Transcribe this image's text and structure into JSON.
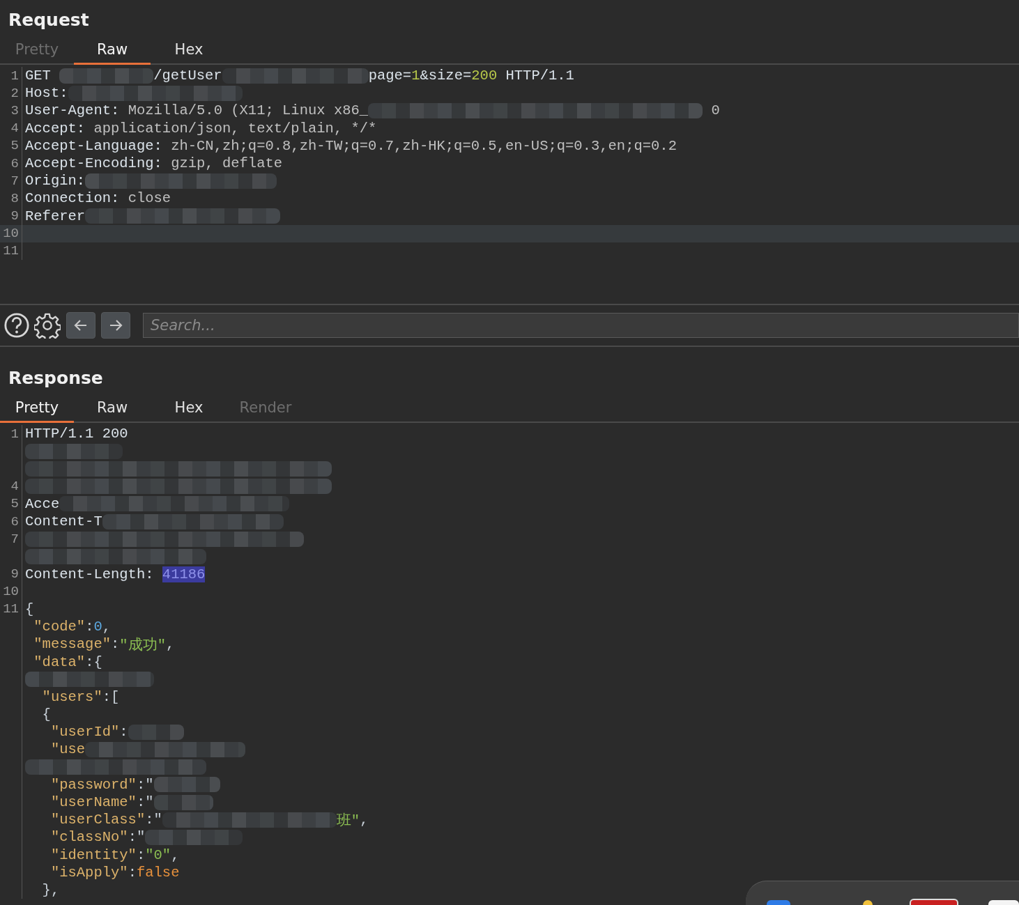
{
  "request": {
    "title": "Request",
    "tabs": [
      {
        "label": "Pretty",
        "selected": false,
        "disabled": true
      },
      {
        "label": "Raw",
        "selected": true,
        "disabled": false
      },
      {
        "label": "Hex",
        "selected": false,
        "disabled": false
      }
    ],
    "lines": [
      {
        "no": "1",
        "highlighted": false,
        "parts": [
          {
            "kind": "name",
            "text": "GET "
          },
          {
            "kind": "redacted"
          },
          {
            "kind": "name",
            "text": "/getUser"
          },
          {
            "kind": "redacted"
          },
          {
            "kind": "name",
            "text": "page="
          },
          {
            "kind": "num",
            "text": "1"
          },
          {
            "kind": "name",
            "text": "&size="
          },
          {
            "kind": "num",
            "text": "200"
          },
          {
            "kind": "name",
            "text": " HTTP/1.1"
          }
        ]
      },
      {
        "no": "2",
        "highlighted": false,
        "parts": [
          {
            "kind": "name",
            "text": "Host:"
          },
          {
            "kind": "redacted"
          }
        ]
      },
      {
        "no": "3",
        "highlighted": false,
        "parts": [
          {
            "kind": "name",
            "text": "User-Agent:"
          },
          {
            "kind": "value",
            "text": " Mozilla/5.0 (X11; Linux x86_"
          },
          {
            "kind": "redacted"
          },
          {
            "kind": "value",
            "text": " 0"
          }
        ]
      },
      {
        "no": "4",
        "highlighted": false,
        "parts": [
          {
            "kind": "name",
            "text": "Accept:"
          },
          {
            "kind": "value",
            "text": " application/json, text/plain, */*"
          }
        ]
      },
      {
        "no": "5",
        "highlighted": false,
        "parts": [
          {
            "kind": "name",
            "text": "Accept-Language:"
          },
          {
            "kind": "value",
            "text": " zh-CN,zh;q=0.8,zh-TW;q=0.7,zh-HK;q=0.5,en-US;q=0.3,en;q=0.2"
          }
        ]
      },
      {
        "no": "6",
        "highlighted": false,
        "parts": [
          {
            "kind": "name",
            "text": "Accept-Encoding:"
          },
          {
            "kind": "value",
            "text": " gzip, deflate"
          }
        ]
      },
      {
        "no": "7",
        "highlighted": false,
        "parts": [
          {
            "kind": "name",
            "text": "Origin:"
          },
          {
            "kind": "redacted"
          }
        ]
      },
      {
        "no": "8",
        "highlighted": false,
        "parts": [
          {
            "kind": "name",
            "text": "Connection:"
          },
          {
            "kind": "value",
            "text": " close"
          }
        ]
      },
      {
        "no": "9",
        "highlighted": false,
        "parts": [
          {
            "kind": "name",
            "text": "Referer"
          },
          {
            "kind": "redacted"
          }
        ]
      },
      {
        "no": "10",
        "highlighted": true
      },
      {
        "no": "11",
        "highlighted": false
      }
    ]
  },
  "toolbar": {
    "search": {
      "placeholder": "Search..."
    }
  },
  "response": {
    "title": "Response",
    "tabs": [
      {
        "label": "Pretty",
        "selected": true,
        "disabled": false
      },
      {
        "label": "Raw",
        "selected": false,
        "disabled": false
      },
      {
        "label": "Hex",
        "selected": false,
        "disabled": false
      },
      {
        "label": "Render",
        "selected": false,
        "disabled": true
      }
    ],
    "lines": [
      {
        "no": "1",
        "highlighted": false,
        "parts": [
          {
            "kind": "name",
            "text": "HTTP/1.1 200"
          }
        ]
      },
      {
        "highlighted": false,
        "parts": [
          {
            "kind": "redacted"
          }
        ]
      },
      {
        "highlighted": false,
        "parts": [
          {
            "kind": "redacted"
          }
        ]
      },
      {
        "no": "4",
        "highlighted": false,
        "parts": [
          {
            "kind": "redacted"
          }
        ]
      },
      {
        "no": "5",
        "highlighted": false,
        "parts": [
          {
            "kind": "name",
            "text": "Acce"
          },
          {
            "kind": "redacted"
          }
        ]
      },
      {
        "no": "6",
        "highlighted": false,
        "parts": [
          {
            "kind": "name",
            "text": "Content-T"
          },
          {
            "kind": "redacted"
          }
        ]
      },
      {
        "no": "7",
        "highlighted": false,
        "parts": [
          {
            "kind": "redacted"
          }
        ]
      },
      {
        "highlighted": false,
        "parts": [
          {
            "kind": "redacted"
          }
        ]
      },
      {
        "no": "9",
        "highlighted": false,
        "parts": [
          {
            "kind": "name",
            "text": "Content-Length: "
          },
          {
            "kind": "selected",
            "text": "41186"
          }
        ]
      },
      {
        "no": "10",
        "highlighted": false
      },
      {
        "no": "11",
        "highlighted": false,
        "parts": [
          {
            "kind": "punct",
            "text": "{"
          }
        ]
      },
      {
        "highlighted": false,
        "parts": [
          {
            "kind": "key",
            "text": " \"code\""
          },
          {
            "kind": "punct",
            "text": ":"
          },
          {
            "kind": "jnum",
            "text": "0"
          },
          {
            "kind": "punct",
            "text": ","
          }
        ]
      },
      {
        "highlighted": false,
        "parts": [
          {
            "kind": "key",
            "text": " \"message\""
          },
          {
            "kind": "punct",
            "text": ":"
          },
          {
            "kind": "jstr",
            "text": "\"成功\""
          },
          {
            "kind": "punct",
            "text": ","
          }
        ]
      },
      {
        "highlighted": false,
        "parts": [
          {
            "kind": "key",
            "text": " \"data\""
          },
          {
            "kind": "punct",
            "text": ":{"
          }
        ]
      },
      {
        "highlighted": false,
        "parts": [
          {
            "kind": "redacted"
          }
        ]
      },
      {
        "highlighted": false,
        "parts": [
          {
            "kind": "key",
            "text": "  \"users\""
          },
          {
            "kind": "punct",
            "text": ":["
          }
        ]
      },
      {
        "highlighted": false,
        "parts": [
          {
            "kind": "punct",
            "text": "  {"
          }
        ]
      },
      {
        "highlighted": false,
        "parts": [
          {
            "kind": "key",
            "text": "   \"userId\""
          },
          {
            "kind": "punct",
            "text": ":"
          },
          {
            "kind": "redacted"
          }
        ]
      },
      {
        "highlighted": false,
        "parts": [
          {
            "kind": "key",
            "text": "   \"use"
          },
          {
            "kind": "redacted"
          }
        ]
      },
      {
        "highlighted": false,
        "parts": [
          {
            "kind": "redacted"
          }
        ]
      },
      {
        "highlighted": false,
        "parts": [
          {
            "kind": "key",
            "text": "   \"password\""
          },
          {
            "kind": "punct",
            "text": ":\""
          },
          {
            "kind": "redacted"
          }
        ]
      },
      {
        "highlighted": false,
        "parts": [
          {
            "kind": "key",
            "text": "   \"userName\""
          },
          {
            "kind": "punct",
            "text": ":\""
          },
          {
            "kind": "redacted"
          }
        ]
      },
      {
        "highlighted": false,
        "parts": [
          {
            "kind": "key",
            "text": "   \"userClass\""
          },
          {
            "kind": "punct",
            "text": ":\""
          },
          {
            "kind": "redacted"
          },
          {
            "kind": "jstr",
            "text": "班\""
          },
          {
            "kind": "punct",
            "text": ","
          }
        ]
      },
      {
        "highlighted": false,
        "parts": [
          {
            "kind": "key",
            "text": "   \"classNo\""
          },
          {
            "kind": "punct",
            "text": ":\""
          },
          {
            "kind": "redacted"
          }
        ]
      },
      {
        "highlighted": false,
        "parts": [
          {
            "kind": "key",
            "text": "   \"identity\""
          },
          {
            "kind": "punct",
            "text": ":"
          },
          {
            "kind": "jstr",
            "text": "\"0\""
          },
          {
            "kind": "punct",
            "text": ","
          }
        ]
      },
      {
        "highlighted": false,
        "parts": [
          {
            "kind": "key",
            "text": "   \"isApply\""
          },
          {
            "kind": "punct",
            "text": ":"
          },
          {
            "kind": "jbool",
            "text": "false"
          }
        ]
      },
      {
        "highlighted": false,
        "parts": [
          {
            "kind": "punct",
            "text": "  },"
          }
        ]
      }
    ]
  }
}
